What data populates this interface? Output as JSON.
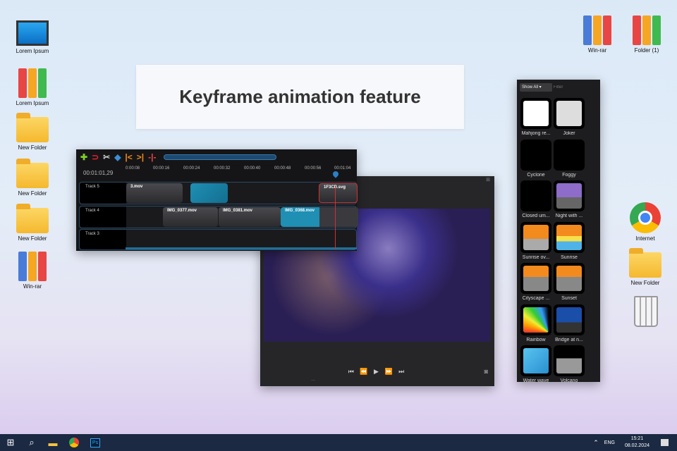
{
  "desktop": {
    "left_icons": [
      "Lorem Ipsum",
      "Lorem Ipsum",
      "New Folder",
      "New Folder",
      "New Folder",
      "Win-rar"
    ],
    "top_right_icons": [
      "Win-rar",
      "Folder (1)"
    ],
    "right_icons": [
      "Internet",
      "New Folder"
    ]
  },
  "banner": {
    "title": "Keyframe animation feature"
  },
  "timeline": {
    "timecode": "00:01:01,29",
    "ticks": [
      "0:00:08",
      "00:00:16",
      "00:00:24",
      "00:00:32",
      "00:00:40",
      "00:00:48",
      "00:00:56",
      "00:01:04"
    ],
    "tracks": [
      {
        "name": "Track 5",
        "clips": [
          "3.mov",
          "1F3CD.svg"
        ]
      },
      {
        "name": "Track 4",
        "clips": [
          "IMG_0377.mov",
          "IMG_0381.mov",
          "IMG_0368.mov"
        ]
      },
      {
        "name": "Track 3",
        "clips": []
      }
    ]
  },
  "player": {
    "controls": "⏮ ⏪ ▶ ⏩ ⏭",
    "status": "..."
  },
  "emoji_panel": {
    "filter_select": "Show All",
    "filter_placeholder": "Filter",
    "items": [
      "Mahjong re...",
      "Joker",
      "Cyclone",
      "Foggy",
      "Closed um...",
      "Night with ...",
      "Sunrise ov...",
      "Sunrise",
      "Cityscape ...",
      "Sunset",
      "Rainbow",
      "Bridge at n...",
      "Water wave",
      "Volcano"
    ]
  },
  "taskbar": {
    "lang": "ENG",
    "time": "15:21",
    "date": "08.02.2024"
  }
}
